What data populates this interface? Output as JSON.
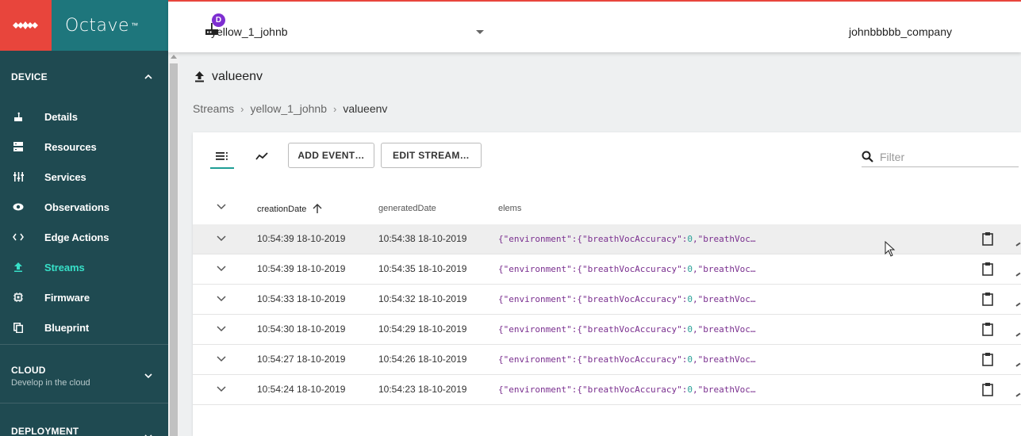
{
  "app": {
    "logo": "Octave",
    "trademark": "™"
  },
  "topbar": {
    "device_badge": "D",
    "device_name": "yellow_1_johnb",
    "company": "johnbbbbb_company"
  },
  "sidebar": {
    "device_section": "DEVICE",
    "items": [
      {
        "label": "Details",
        "icon": "router-icon"
      },
      {
        "label": "Resources",
        "icon": "storage-icon"
      },
      {
        "label": "Services",
        "icon": "tune-icon"
      },
      {
        "label": "Observations",
        "icon": "eye-icon"
      },
      {
        "label": "Edge Actions",
        "icon": "code-icon"
      },
      {
        "label": "Streams",
        "icon": "upload-icon",
        "active": true
      },
      {
        "label": "Firmware",
        "icon": "chip-icon"
      },
      {
        "label": "Blueprint",
        "icon": "copy-icon"
      }
    ],
    "cloud_section": "CLOUD",
    "cloud_sub": "Develop in the cloud",
    "deployment_section": "DEPLOYMENT"
  },
  "page": {
    "title": "valueenv",
    "breadcrumb": [
      "Streams",
      "yellow_1_johnb",
      "valueenv"
    ]
  },
  "toolbar": {
    "add_event": "ADD EVENT…",
    "edit_stream": "EDIT STREAM…",
    "filter_placeholder": "Filter"
  },
  "table": {
    "headers": [
      "creationDate",
      "generatedDate",
      "elems"
    ],
    "sorted_column": "creationDate",
    "sort_direction": "ascending",
    "rows": [
      {
        "creation": "10:54:39 18-10-2019",
        "generated": "10:54:38 18-10-2019",
        "elems_pre": "{\"environment\":{\"breathVocAccuracy\":",
        "elems_num": "0",
        "elems_post": ",\"breathVoc…",
        "highlighted": true
      },
      {
        "creation": "10:54:39 18-10-2019",
        "generated": "10:54:35 18-10-2019",
        "elems_pre": "{\"environment\":{\"breathVocAccuracy\":",
        "elems_num": "0",
        "elems_post": ",\"breathVoc…"
      },
      {
        "creation": "10:54:33 18-10-2019",
        "generated": "10:54:32 18-10-2019",
        "elems_pre": "{\"environment\":{\"breathVocAccuracy\":",
        "elems_num": "0",
        "elems_post": ",\"breathVoc…"
      },
      {
        "creation": "10:54:30 18-10-2019",
        "generated": "10:54:29 18-10-2019",
        "elems_pre": "{\"environment\":{\"breathVocAccuracy\":",
        "elems_num": "0",
        "elems_post": ",\"breathVoc…"
      },
      {
        "creation": "10:54:27 18-10-2019",
        "generated": "10:54:26 18-10-2019",
        "elems_pre": "{\"environment\":{\"breathVocAccuracy\":",
        "elems_num": "0",
        "elems_post": ",\"breathVoc…"
      },
      {
        "creation": "10:54:24 18-10-2019",
        "generated": "10:54:23 18-10-2019",
        "elems_pre": "{\"environment\":{\"breathVocAccuracy\":",
        "elems_num": "0",
        "elems_post": ",\"breathVoc…"
      }
    ]
  },
  "colors": {
    "brand_red": "#e8453c",
    "brand_teal": "#1e767c",
    "sidebar_bg": "#1f4a51",
    "active_text": "#37e0c8",
    "badge": "#7e2fd1"
  }
}
